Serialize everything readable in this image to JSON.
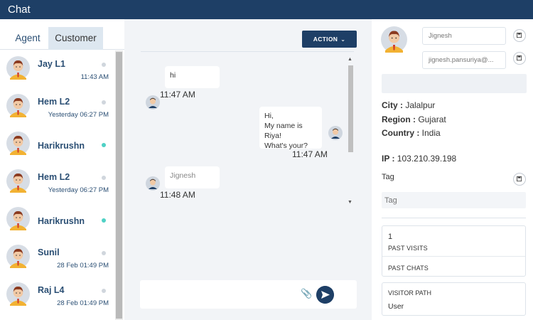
{
  "app": {
    "title": "Chat"
  },
  "tabs": [
    {
      "label": "Agent",
      "active": false
    },
    {
      "label": "Customer",
      "active": true
    }
  ],
  "contacts": [
    {
      "name": "Jay L1",
      "time": "11:43 AM",
      "online": false
    },
    {
      "name": "Hem L2",
      "time": "Yesterday 06:27 PM",
      "online": false
    },
    {
      "name": "Harikrushn",
      "time": "",
      "online": true
    },
    {
      "name": "Hem L2",
      "time": "Yesterday 06:27 PM",
      "online": false
    },
    {
      "name": "Harikrushn",
      "time": "",
      "online": true
    },
    {
      "name": "Sunil",
      "time": "28 Feb 01:49 PM",
      "online": false
    },
    {
      "name": "Raj L4",
      "time": "28 Feb 01:49 PM",
      "online": false
    }
  ],
  "chat": {
    "action_label": "ACTION",
    "messages": [
      {
        "side": "left",
        "lines": [
          "hi"
        ],
        "time": "11:47 AM"
      },
      {
        "side": "right",
        "lines": [
          "Hi,",
          "My name is Riya!",
          "What's your?"
        ],
        "time": "11:47 AM"
      },
      {
        "side": "left",
        "lines": [
          "Jignesh"
        ],
        "time": "11:48 AM"
      }
    ],
    "composer_placeholder": ""
  },
  "visitor": {
    "name": "Jignesh",
    "email": "jignesh.pansuriya@...",
    "city_label": "City :",
    "city": "Jalalpur",
    "region_label": "Region :",
    "region": "Gujarat",
    "country_label": "Country :",
    "country": "India",
    "ip_label": "IP :",
    "ip": "103.210.39.198",
    "tag_label": "Tag",
    "tag_placeholder": "Tag",
    "visits_count": "1",
    "past_visits_label": "PAST VISITS",
    "past_chats_label": "PAST CHATS",
    "visitor_path_label": "VISITOR PATH",
    "visitor_path": "User"
  },
  "colors": {
    "brand": "#1e3f66",
    "online": "#4fd1c5",
    "offline": "#d0d6dd"
  }
}
